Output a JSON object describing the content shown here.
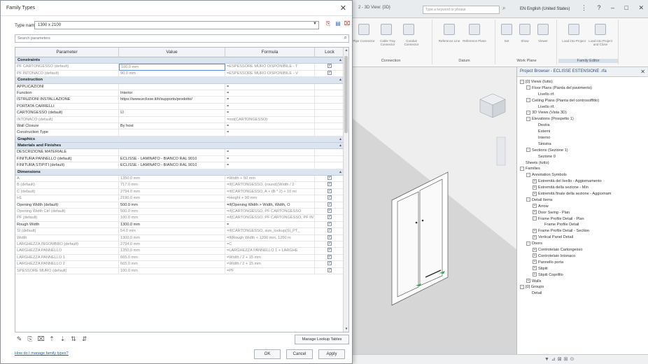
{
  "app": {
    "doc_title": "2 - 3D View: {3D}",
    "keyword_search_placeholder": "Type a keyword or phrase",
    "language": "EN English (United States)",
    "ribbon_groups": [
      {
        "label": "Connection",
        "items": [
          "Pipe Connector",
          "Cable Tray Connector",
          "Conduit Connector"
        ]
      },
      {
        "label": "Datum",
        "items": [
          "Reference Line",
          "Reference Plane"
        ]
      },
      {
        "label": "Work Plane",
        "items": [
          "Set",
          "Show",
          "Viewer"
        ]
      },
      {
        "label": "Family Editor",
        "items": [
          "Load into Project",
          "Load into Project and Close"
        ]
      }
    ],
    "viewport_scale_label": "1 : 20"
  },
  "browser": {
    "title": "Project Browser - ECLISSE ESTENSIONE .rfa",
    "items": [
      {
        "level": 0,
        "toggle": "-",
        "label": "[0] Views (tutto)"
      },
      {
        "level": 1,
        "toggle": "-",
        "label": "Floor Plans (Pianta del pavimento)"
      },
      {
        "level": 2,
        "toggle": "",
        "label": "Livello rif."
      },
      {
        "level": 1,
        "toggle": "-",
        "label": "Ceiling Plans (Pianta del controsoffitto)"
      },
      {
        "level": 2,
        "toggle": "",
        "label": "Livello rif."
      },
      {
        "level": 1,
        "toggle": "-",
        "label": "3D Views (Vista 3D)"
      },
      {
        "level": 1,
        "toggle": "-",
        "label": "Elevations (Prospetto 1)"
      },
      {
        "level": 2,
        "toggle": "",
        "label": "Destra"
      },
      {
        "level": 2,
        "toggle": "",
        "label": "Esterni"
      },
      {
        "level": 2,
        "toggle": "",
        "label": "Interno"
      },
      {
        "level": 2,
        "toggle": "",
        "label": "Sinistra"
      },
      {
        "level": 1,
        "toggle": "-",
        "label": "Sections (Sezione 1)"
      },
      {
        "level": 2,
        "toggle": "",
        "label": "Sezione 0"
      },
      {
        "level": 0,
        "toggle": "",
        "label": "Sheets (tutto)"
      },
      {
        "level": 0,
        "toggle": "-",
        "label": "Families"
      },
      {
        "level": 1,
        "toggle": "-",
        "label": "Annotation Symbols"
      },
      {
        "level": 2,
        "toggle": "+",
        "label": "Estremità del livello - Aggiornamento"
      },
      {
        "level": 2,
        "toggle": "+",
        "label": "Estremità della sezione - Min"
      },
      {
        "level": 2,
        "toggle": "+",
        "label": "Estremità finale della sezione - Aggiornam"
      },
      {
        "level": 1,
        "toggle": "-",
        "label": "Detail Items"
      },
      {
        "level": 2,
        "toggle": "+",
        "label": "Arrow"
      },
      {
        "level": 2,
        "toggle": "+",
        "label": "Door Swing - Plan"
      },
      {
        "level": 2,
        "toggle": "-",
        "label": "Frame Profile Detail - Plan"
      },
      {
        "level": 3,
        "toggle": "",
        "label": "Frame Profile Detail"
      },
      {
        "level": 2,
        "toggle": "+",
        "label": "Frame Profile Detail - Section"
      },
      {
        "level": 2,
        "toggle": "+",
        "label": "Vertical Panel Detail"
      },
      {
        "level": 1,
        "toggle": "-",
        "label": "Doors"
      },
      {
        "level": 2,
        "toggle": "+",
        "label": "Controtelaio Cartongesso"
      },
      {
        "level": 2,
        "toggle": "+",
        "label": "Controtelaio Intonaco"
      },
      {
        "level": 2,
        "toggle": "+",
        "label": "Pannello porta"
      },
      {
        "level": 2,
        "toggle": "+",
        "label": "Stipiti"
      },
      {
        "level": 2,
        "toggle": "+",
        "label": "Stipiti Coprifilo"
      },
      {
        "level": 1,
        "toggle": "+",
        "label": "Walls"
      },
      {
        "level": 0,
        "toggle": "-",
        "label": "[0] Groups"
      },
      {
        "level": 1,
        "toggle": "",
        "label": "Detail"
      }
    ]
  },
  "dialog": {
    "title": "Family Types",
    "type_name_label": "Type name:",
    "type_name_value": "1300 x 2100",
    "search_placeholder": "Search parameters",
    "columns": [
      "Parameter",
      "Value",
      "Formula",
      "Lock"
    ],
    "rows": [
      {
        "kind": "section",
        "label": "Constraints"
      },
      {
        "kind": "param",
        "grey": true,
        "param": "PF CARTONGESSO (default)",
        "value": "100.0 mm",
        "formula": "=ESPESSORE MURO DISPONIBILE - T",
        "lock": true,
        "highlight": true
      },
      {
        "kind": "param",
        "grey": true,
        "param": "PF INTONACO (default)",
        "value": "90.0 mm",
        "formula": "=ESPESSORE MURO DISPONIBILE - V",
        "lock": true
      },
      {
        "kind": "section",
        "label": "Construction"
      },
      {
        "kind": "param",
        "param": "APPLICAZIONI",
        "value": "",
        "formula": "=",
        "lock": null
      },
      {
        "kind": "param",
        "param": "Function",
        "value": "Interior",
        "formula": "=",
        "lock": null
      },
      {
        "kind": "param",
        "param": "ISTRUZIONI INSTALLAZIONE",
        "value": "https://www.eclisse.it/it/supporto/prodotto/",
        "formula": "=",
        "lock": null
      },
      {
        "kind": "param",
        "param": "PORTATA CARRELLI",
        "value": "",
        "formula": "=",
        "lock": null
      },
      {
        "kind": "param",
        "param": "CARTONGESSO (default)",
        "value": "☑",
        "formula": "=",
        "lock": null
      },
      {
        "kind": "param",
        "grey": true,
        "param": "INTONACO (default)",
        "value": "",
        "formula": "=not(CARTONGESSO)",
        "lock": null
      },
      {
        "kind": "param",
        "param": "Wall Closure",
        "value": "By host",
        "formula": "=",
        "lock": null
      },
      {
        "kind": "param",
        "param": "Construction Type",
        "value": "",
        "formula": "=",
        "lock": null
      },
      {
        "kind": "section",
        "label": "Graphics"
      },
      {
        "kind": "section",
        "label": "Materials and Finishes"
      },
      {
        "kind": "param",
        "param": "DESCRIZIONE MATERIALE",
        "value": "",
        "formula": "=",
        "lock": null
      },
      {
        "kind": "param",
        "param": "FINITURA PANNELLO (default)",
        "value": "ECLISSE - LAMINATO - BIANCO RAL 9010",
        "formula": "=",
        "lock": null
      },
      {
        "kind": "param",
        "param": "FINITURA STIPITI (default)",
        "value": "ECLISSE - LAMINATO - BIANCO RAL 9010",
        "formula": "=",
        "lock": null
      },
      {
        "kind": "section",
        "label": "Dimensions"
      },
      {
        "kind": "param",
        "grey": true,
        "param": "A",
        "value": "1350.0 mm",
        "formula": "=Width + 50 mm",
        "lock": true
      },
      {
        "kind": "param",
        "grey": true,
        "param": "B (default)",
        "value": "717.0 mm",
        "formula": "=if(CARTONGESSO, (round((Width / 2",
        "lock": true
      },
      {
        "kind": "param",
        "grey": true,
        "param": "C (default)",
        "value": "2794.0 mm",
        "formula": "=if(CARTONGESSO, A + (B * 2) + 10 mi",
        "lock": true
      },
      {
        "kind": "param",
        "grey": true,
        "param": "H1",
        "value": "2190.0 mm",
        "formula": "=Height + 90 mm",
        "lock": true
      },
      {
        "kind": "param",
        "param": "Opening Width (default)",
        "value": "500.0 mm",
        "formula": "=if(Opening Width > Width, Width, O",
        "lock": true
      },
      {
        "kind": "param",
        "grey": true,
        "param": "Opening Width Ctrl (default)",
        "value": "500.0 mm",
        "formula": "=if(CARTONGESSO, PF CARTONGESSO",
        "lock": true
      },
      {
        "kind": "param",
        "grey": true,
        "param": "PF (default)",
        "value": "100.0 mm",
        "formula": "=if(CARTONGESSO, PF CARTONGESSO, PF INT",
        "lock": true
      },
      {
        "kind": "param",
        "param": "Rough Width",
        "value": "1300.0 mm",
        "formula": "=",
        "lock": true
      },
      {
        "kind": "param",
        "grey": true,
        "param": "SI (default)",
        "value": "54.0 mm",
        "formula": "=if(CARTONGESSO, size_lookup(SI_PT_",
        "lock": true
      },
      {
        "kind": "param",
        "grey": true,
        "param": "Width",
        "value": "1300.0 mm",
        "formula": "=if(Rough Width < 1200 mm, 1200 m",
        "lock": true
      },
      {
        "kind": "param",
        "grey": true,
        "param": "LARGHEZZA INGOMBRO (default)",
        "value": "2794.0 mm",
        "formula": "=C",
        "lock": true
      },
      {
        "kind": "param",
        "grey": true,
        "param": "LARGHEZZA PANNELLO",
        "value": "1350.0 mm",
        "formula": "=LARGHEZZA PANNELLO 1 + LARGHE",
        "lock": true
      },
      {
        "kind": "param",
        "grey": true,
        "param": "LARGHEZZA PANNELLO 1",
        "value": "665.0 mm",
        "formula": "=Width / 2 + 15 mm",
        "lock": true
      },
      {
        "kind": "param",
        "grey": true,
        "param": "LARGHEZZA PANNELLO 2",
        "value": "665.0 mm",
        "formula": "=Width / 2 + 15 mm",
        "lock": true
      },
      {
        "kind": "param",
        "grey": true,
        "param": "SPESSORE MURO (default)",
        "value": "100.0 mm",
        "formula": "=PF",
        "lock": true
      }
    ],
    "manage_lookup_label": "Manage Lookup Tables",
    "howto_link": "How do I manage family types?",
    "ok_label": "OK",
    "cancel_label": "Cancel",
    "apply_label": "Apply"
  }
}
